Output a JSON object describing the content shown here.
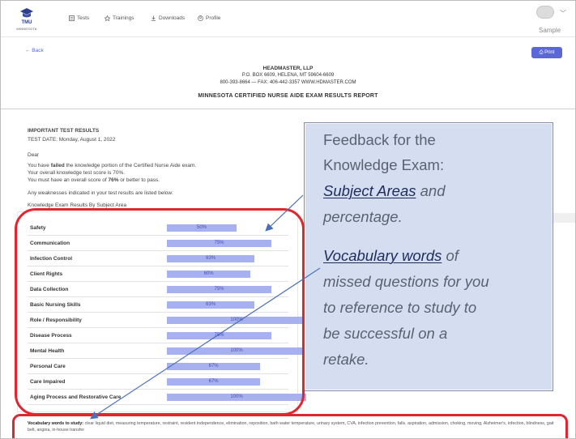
{
  "nav": {
    "logo_line1": "TMU",
    "logo_line2": "MINNESOTA",
    "tests": "Tests",
    "trainings": "Trainings",
    "downloads": "Downloads",
    "profile": "Profile",
    "user": "Sample"
  },
  "actions": {
    "back": "← Back",
    "print": "Print"
  },
  "header": {
    "company": "HEADMASTER, LLP",
    "address": "P.O. BOX 6609, HELENA, MT 59604-6609",
    "contact": "800-393-8664 — FAX: 406-442-3357 WWW.HDMASTER.COM",
    "report_title": "MINNESOTA CERTIFIED NURSE AIDE EXAM RESULTS REPORT"
  },
  "results": {
    "heading": "IMPORTANT TEST RESULTS",
    "test_date": "TEST DATE: Monday, August 1, 2022",
    "dear": "Dear",
    "l1_a": "You have ",
    "l1_b": "failed",
    "l1_c": " the knowledge portion of the Certified Nurse Aide exam.",
    "l2": "Your overall knowledge test score is 70%.",
    "l3_a": "You must have an overall score of ",
    "l3_b": "76%",
    "l3_c": " or better to pass.",
    "l4": "Any weaknesses indicated in your test results are listed below:",
    "table_title": "Knowledge Exam Results By Subject Area"
  },
  "subjects": [
    {
      "name": "Safety",
      "percent": 50
    },
    {
      "name": "Communication",
      "percent": 75
    },
    {
      "name": "Infection Control",
      "percent": 63
    },
    {
      "name": "Client Rights",
      "percent": 60
    },
    {
      "name": "Data Collection",
      "percent": 75
    },
    {
      "name": "Basic Nursing Skills",
      "percent": 63
    },
    {
      "name": "Role / Responsibility",
      "percent": 100
    },
    {
      "name": "Disease Process",
      "percent": 75
    },
    {
      "name": "Mental Health",
      "percent": 100
    },
    {
      "name": "Personal Care",
      "percent": 67
    },
    {
      "name": "Care Impaired",
      "percent": 67
    },
    {
      "name": "Aging Process and Restorative Care",
      "percent": 100
    }
  ],
  "vocab": {
    "label": "Vocabulary words to study:",
    "words": "clear liquid diet, measuring temperature, restraint, resident independence, elimination, reposition, bath water temperature, urinary system, CVA, infection prevention, falls, aspiration, admission, choking, moving, Alzheimer's, infection, blindness, gait belt, angina, in-house transfer"
  },
  "callout": {
    "l1": "Feedback for the",
    "l2": "Knowledge Exam:",
    "l3_em": "Subject Areas",
    "l3_rest": " and",
    "l4": "percentage.",
    "l5_em": "Vocabulary words",
    "l5_rest": " of",
    "l6": "missed questions for you",
    "l7": "to reference to study to",
    "l8": "be successful on a",
    "l9": "retake."
  },
  "colors": {
    "accent": "#5b67d6",
    "bar": "#a7b1ef",
    "annotation_red": "#e0262f",
    "callout_bg": "#d4def0"
  }
}
